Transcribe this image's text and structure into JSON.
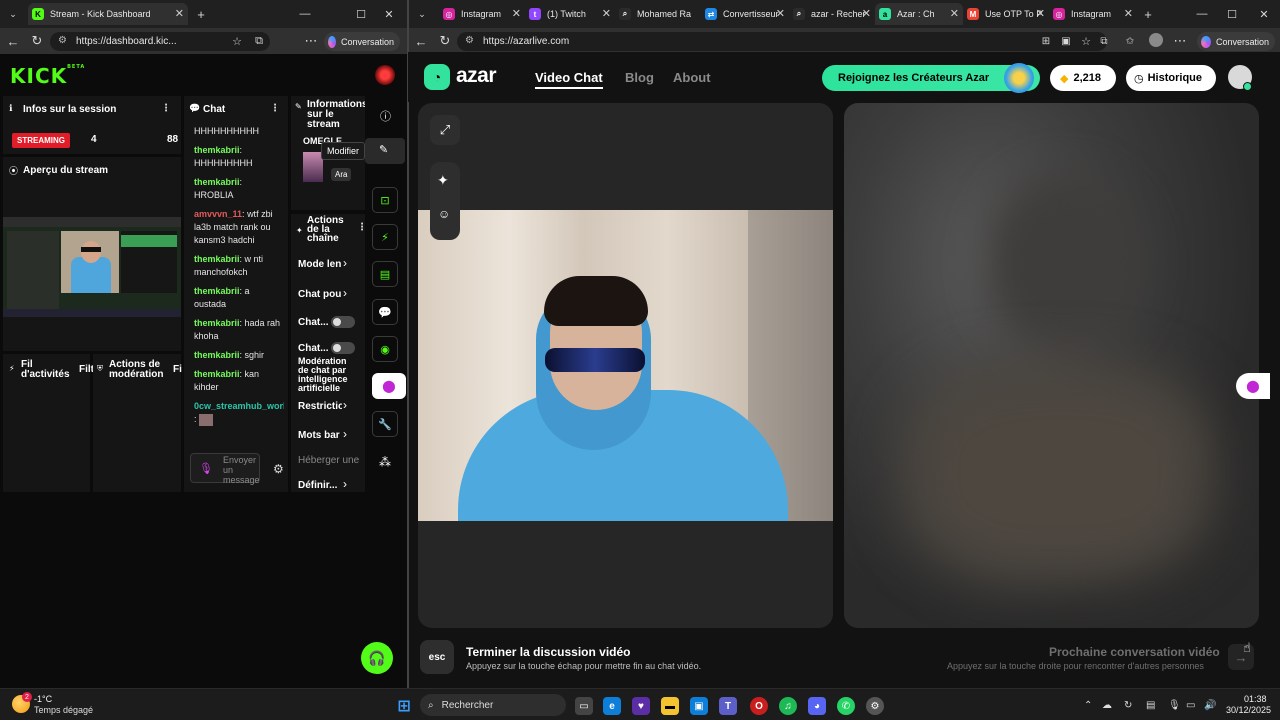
{
  "left_window": {
    "tab": {
      "title": "Stream - Kick Dashboard"
    },
    "url": "https://dashboard.kic...",
    "copilot_label": "Conversation"
  },
  "right_window": {
    "tabs": [
      {
        "title": "Instagram",
        "icon": "instagram-icon",
        "color": "#d6249f"
      },
      {
        "title": "(1) Twitch",
        "icon": "twitch-icon",
        "color": "#9146ff"
      },
      {
        "title": "Mohamed Ra",
        "icon": "search-icon",
        "color": "#2b2b2b"
      },
      {
        "title": "Convertisseur",
        "icon": "convert-icon",
        "color": "#1e88e5"
      },
      {
        "title": "azar - Recher",
        "icon": "search-icon",
        "color": "#2b2b2b"
      },
      {
        "title": "Azar : Ch",
        "icon": "azar-icon",
        "color": "#33e29c"
      },
      {
        "title": "Use OTP To P",
        "icon": "gmail-icon",
        "color": "#ea4335"
      },
      {
        "title": "Instagram",
        "icon": "instagram-icon",
        "color": "#d6249f"
      }
    ],
    "url": "https://azarlive.com",
    "copilot_label": "Conversation"
  },
  "kick": {
    "logo": "KICK",
    "logo_sup": "BETA",
    "session_title": "Infos sur la session",
    "streaming_badge": "STREAMING",
    "stat1": "4",
    "stat2": "88",
    "preview_title": "Aperçu du stream",
    "activity_title": "Fil d'activités",
    "activity_filter": "Filt",
    "moderation_title": "Actions de modération",
    "moderation_filter": "Fi",
    "chat_title": "Chat",
    "chat": [
      {
        "user": "",
        "text": "HHHHHHHHHH"
      },
      {
        "user": "themkabrii",
        "text": "HHHHHHHHH"
      },
      {
        "user": "themkabrii",
        "text": "HROBLIA"
      },
      {
        "user": "amvvvn_11",
        "text": "wtf zbi la3b match rank ou kansm3 hadchi"
      },
      {
        "user": "themkabrii",
        "text": "w nti manchofokch"
      },
      {
        "user": "themkabrii",
        "text": "a oustada"
      },
      {
        "user": "themkabrii",
        "text": "hada rah khoha"
      },
      {
        "user": "themkabrii",
        "text": "sghir"
      },
      {
        "user": "themkabrii",
        "text": "kan kihder"
      },
      {
        "user": "0cw_streamhub_worl",
        "text": ""
      }
    ],
    "chat_input_placeholder": "Envoyer un message",
    "info_title": "Informations sur le stream",
    "info_game": "OMEGLE",
    "info_tag": "Ara",
    "tooltip": "Modifier",
    "actions_title": "Actions de la chaîne",
    "actions": [
      "Mode len",
      "Chat pou",
      "Chat...",
      "Chat...",
      "Restrictio",
      "Mots bar",
      "Définir..."
    ],
    "ai_mod_label": "Modération de chat par intelligence artificielle",
    "host_placeholder": "Héberger une"
  },
  "azar": {
    "brand": "azar",
    "nav": [
      "Video Chat",
      "Blog",
      "About"
    ],
    "creators_button": "Rejoignez les Créateurs Azar",
    "gems": "2,218",
    "history": "Historique",
    "end_key": "esc",
    "end_title": "Terminer la discussion vidéo",
    "end_sub": "Appuyez sur la touche échap pour mettre fin au chat vidéo.",
    "next_title": "Prochaine conversation vidéo",
    "next_sub": "Appuyez sur la touche droite pour rencontrer d'autres personnes"
  },
  "taskbar": {
    "weather_temp": "-1°C",
    "weather_desc": "Temps dégagé",
    "search": "Rechercher",
    "time": "01:38",
    "date": "30/12/2025",
    "weather_badge": "2"
  }
}
